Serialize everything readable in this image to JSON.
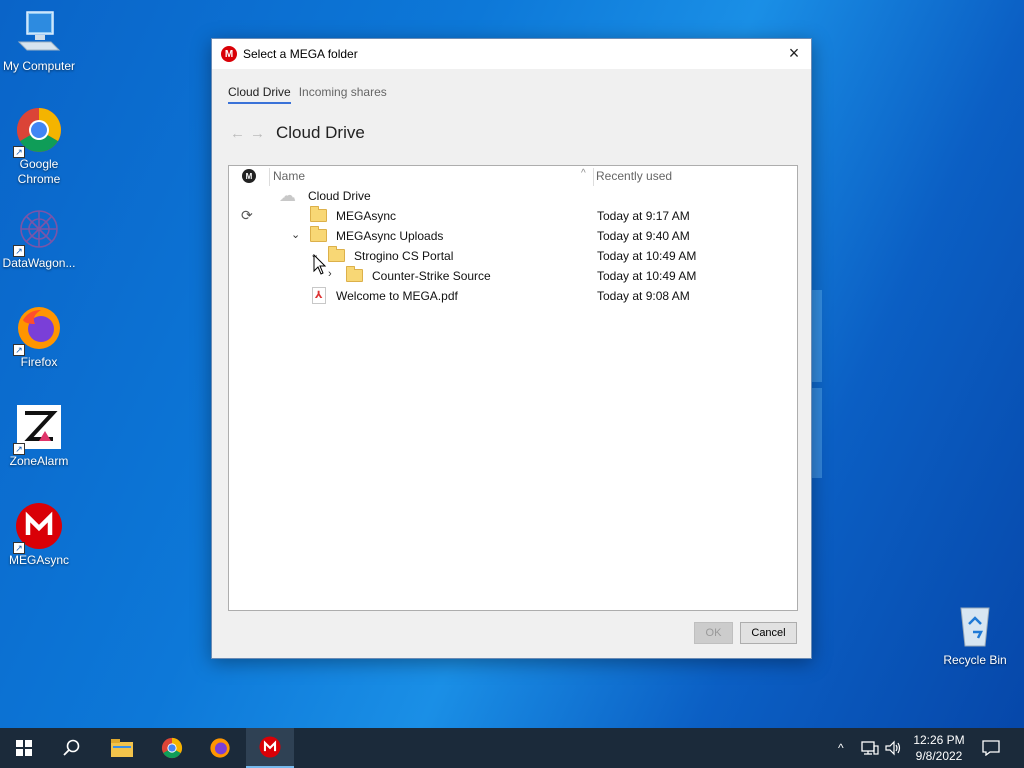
{
  "desktop": {
    "icons": [
      {
        "label": "My Computer"
      },
      {
        "label": "Google Chrome"
      },
      {
        "label": "DataWagon..."
      },
      {
        "label": "Firefox"
      },
      {
        "label": "ZoneAlarm"
      },
      {
        "label": "MEGAsync"
      },
      {
        "label": "Recycle Bin"
      }
    ]
  },
  "dialog": {
    "title": "Select a MEGA folder",
    "logo": "M",
    "tabs": [
      {
        "label": "Cloud Drive",
        "active": true
      },
      {
        "label": "Incoming shares",
        "active": false
      }
    ],
    "location_title": "Cloud Drive",
    "columns": {
      "name": "Name",
      "recently_used": "Recently used"
    },
    "rows": [
      {
        "name": "Cloud Drive",
        "date": "",
        "icon": "cloud-icon"
      },
      {
        "name": "MEGAsync",
        "date": "Today at 9:17 AM",
        "icon": "folder-icon"
      },
      {
        "name": "MEGAsync Uploads",
        "date": "Today at 9:40 AM",
        "icon": "folder-icon",
        "expanded": true
      },
      {
        "name": "Strogino CS Portal",
        "date": "Today at 10:49 AM",
        "icon": "folder-icon",
        "expanded": true
      },
      {
        "name": "Counter-Strike Source",
        "date": "Today at 10:49 AM",
        "icon": "folder-icon",
        "expanded": false
      },
      {
        "name": "Welcome to MEGA.pdf",
        "date": "Today at 9:08 AM",
        "icon": "pdf-icon"
      }
    ],
    "buttons": {
      "ok": "OK",
      "cancel": "Cancel"
    }
  },
  "taskbar": {
    "time": "12:26 PM",
    "date": "9/8/2022"
  }
}
